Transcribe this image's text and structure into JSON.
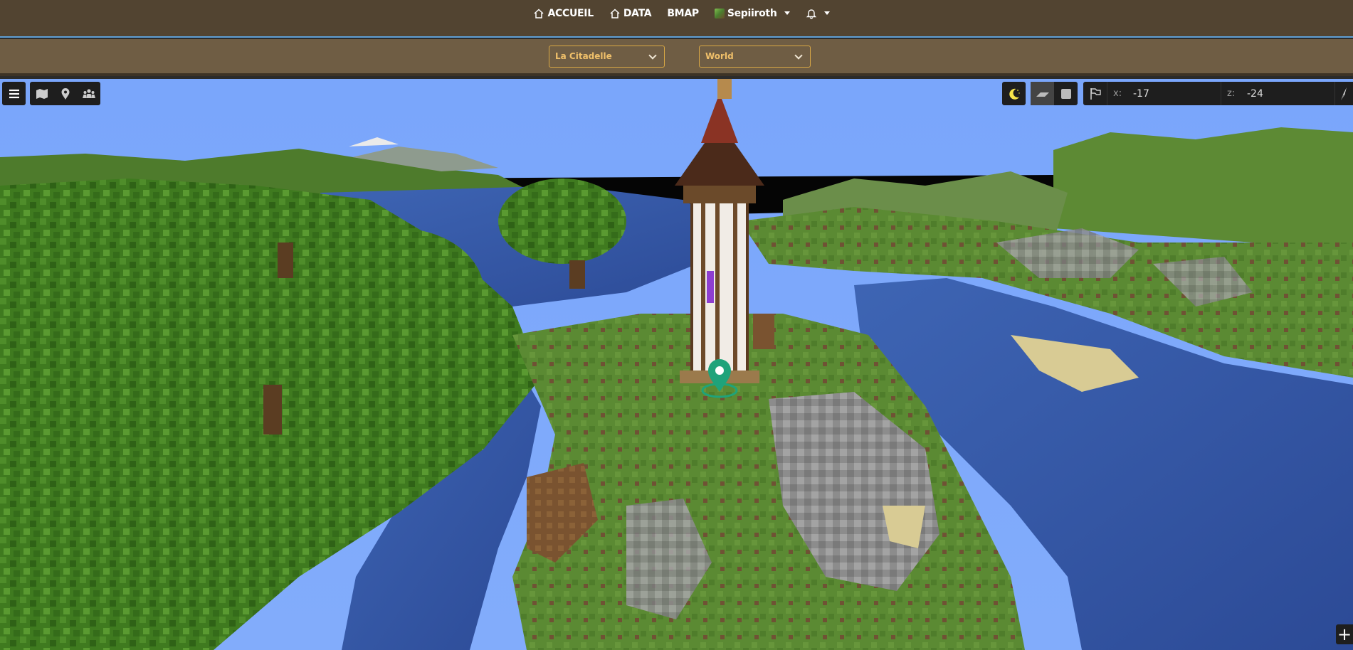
{
  "nav": {
    "accueil": "ACCUEIL",
    "data": "DATA",
    "bmap": "BMAP",
    "user": "Sepiiroth"
  },
  "selects": {
    "server": "La Citadelle",
    "world": "World"
  },
  "coords": {
    "x_label": "x:",
    "x_value": "-17",
    "z_label": "z:",
    "z_value": "-24"
  },
  "zoom": {
    "plus": "+"
  },
  "colors": {
    "nav_bg": "#524431",
    "select_bar_bg": "#6f5d44",
    "select_accent": "#d9a845",
    "sky": "#7ba7fb",
    "marker": "#1fa37a"
  },
  "icons": [
    "home-icon",
    "home-icon",
    "bell-icon",
    "menu-icon",
    "map-icon",
    "marker-icon",
    "players-icon",
    "moon-icon",
    "perspective-icon",
    "flat-icon",
    "flag-icon",
    "compass-icon"
  ]
}
